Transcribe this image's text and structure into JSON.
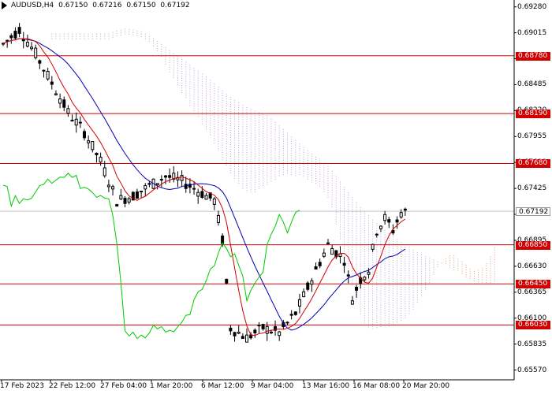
{
  "header": {
    "symbol": "AUDUSD,H4",
    "open": "0.67150",
    "high": "0.67216",
    "low": "0.67150",
    "close": "0.67192"
  },
  "colors": {
    "level_line": "#d00000",
    "candle": "#000000",
    "tenkan": "#d00000",
    "kijun": "#0000b0",
    "chikou": "#00cc00",
    "cloud_a": "#e0a080",
    "cloud_b": "#c0a0d0",
    "current_price_box": "#ffffff"
  },
  "price_axis": {
    "ticks": [
      "0.69280",
      "0.69015",
      "0.68750",
      "0.68485",
      "0.68220",
      "0.67955",
      "0.67690",
      "0.67425",
      "0.67160",
      "0.66895",
      "0.66630",
      "0.66365",
      "0.66100",
      "0.65835",
      "0.65570"
    ],
    "current_price": "0.67192"
  },
  "levels": [
    "0.68780",
    "0.68190",
    "0.67680",
    "0.66850",
    "0.66450",
    "0.66030"
  ],
  "time_axis": [
    "17 Feb 2023",
    "22 Feb 12:00",
    "27 Feb 04:00",
    "1 Mar 20:00",
    "6 Mar 12:00",
    "9 Mar 04:00",
    "13 Mar 16:00",
    "16 Mar 08:00",
    "20 Mar 20:00"
  ]
}
